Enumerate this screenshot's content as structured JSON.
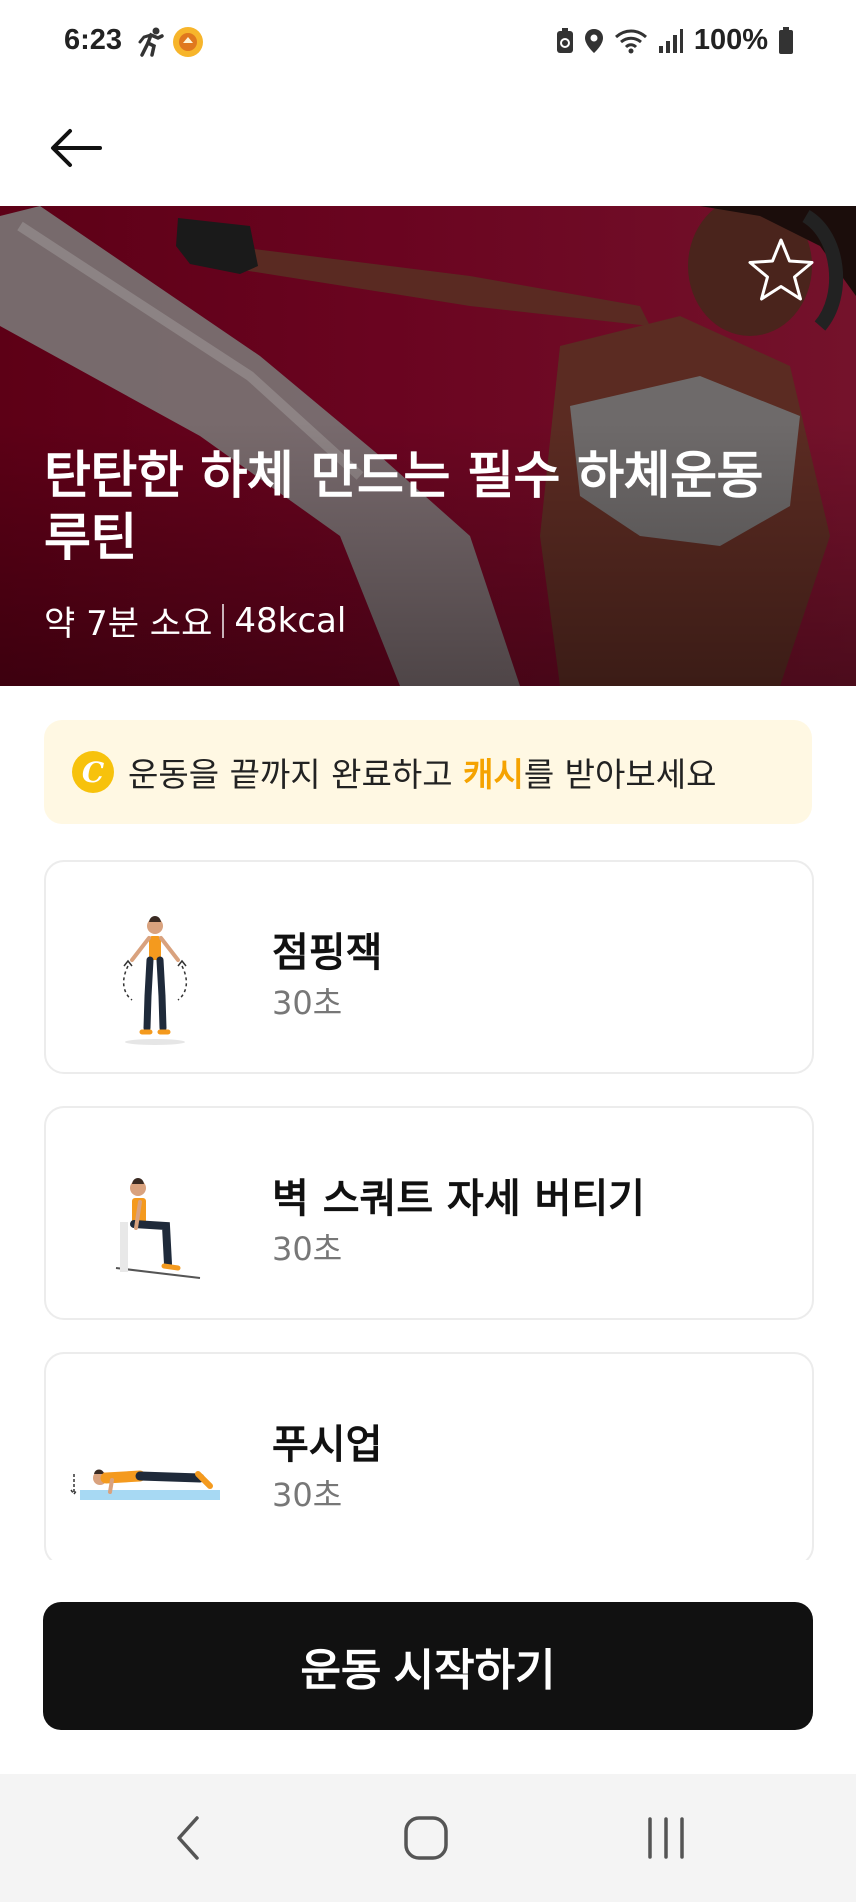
{
  "status_bar": {
    "time": "6:23",
    "battery_percent": "100%",
    "icons": [
      "runner-icon",
      "app-coin-icon",
      "battery-saver-icon",
      "location-icon",
      "wifi-icon",
      "signal-icon",
      "battery-icon"
    ]
  },
  "header": {
    "back_icon": "arrow-left-icon"
  },
  "hero": {
    "title": "탄탄한 하체 만드는 필수 하체운동 루틴",
    "duration": "약 7분 소요",
    "calories": "48kcal",
    "favorite_icon": "star-outline-icon",
    "background_color": "#6a0420"
  },
  "cash_banner": {
    "coin_letter": "C",
    "text_before": "운동을 끝까지 완료하고 ",
    "highlight": "캐시",
    "text_after": "를 받아보세요",
    "highlight_color": "#f5a300",
    "background_color": "#fff8e3"
  },
  "exercises": [
    {
      "name": "점핑잭",
      "duration": "30초",
      "icon": "jumping-jack-figure"
    },
    {
      "name": "벽 스쿼트 자세 버티기",
      "duration": "30초",
      "icon": "wall-sit-figure"
    },
    {
      "name": "푸시업",
      "duration": "30초",
      "icon": "push-up-figure"
    }
  ],
  "start_button": {
    "label": "운동 시작하기",
    "color": "#111111"
  },
  "nav_bar": {
    "icons": [
      "nav-back-icon",
      "nav-home-icon",
      "nav-recents-icon"
    ]
  }
}
